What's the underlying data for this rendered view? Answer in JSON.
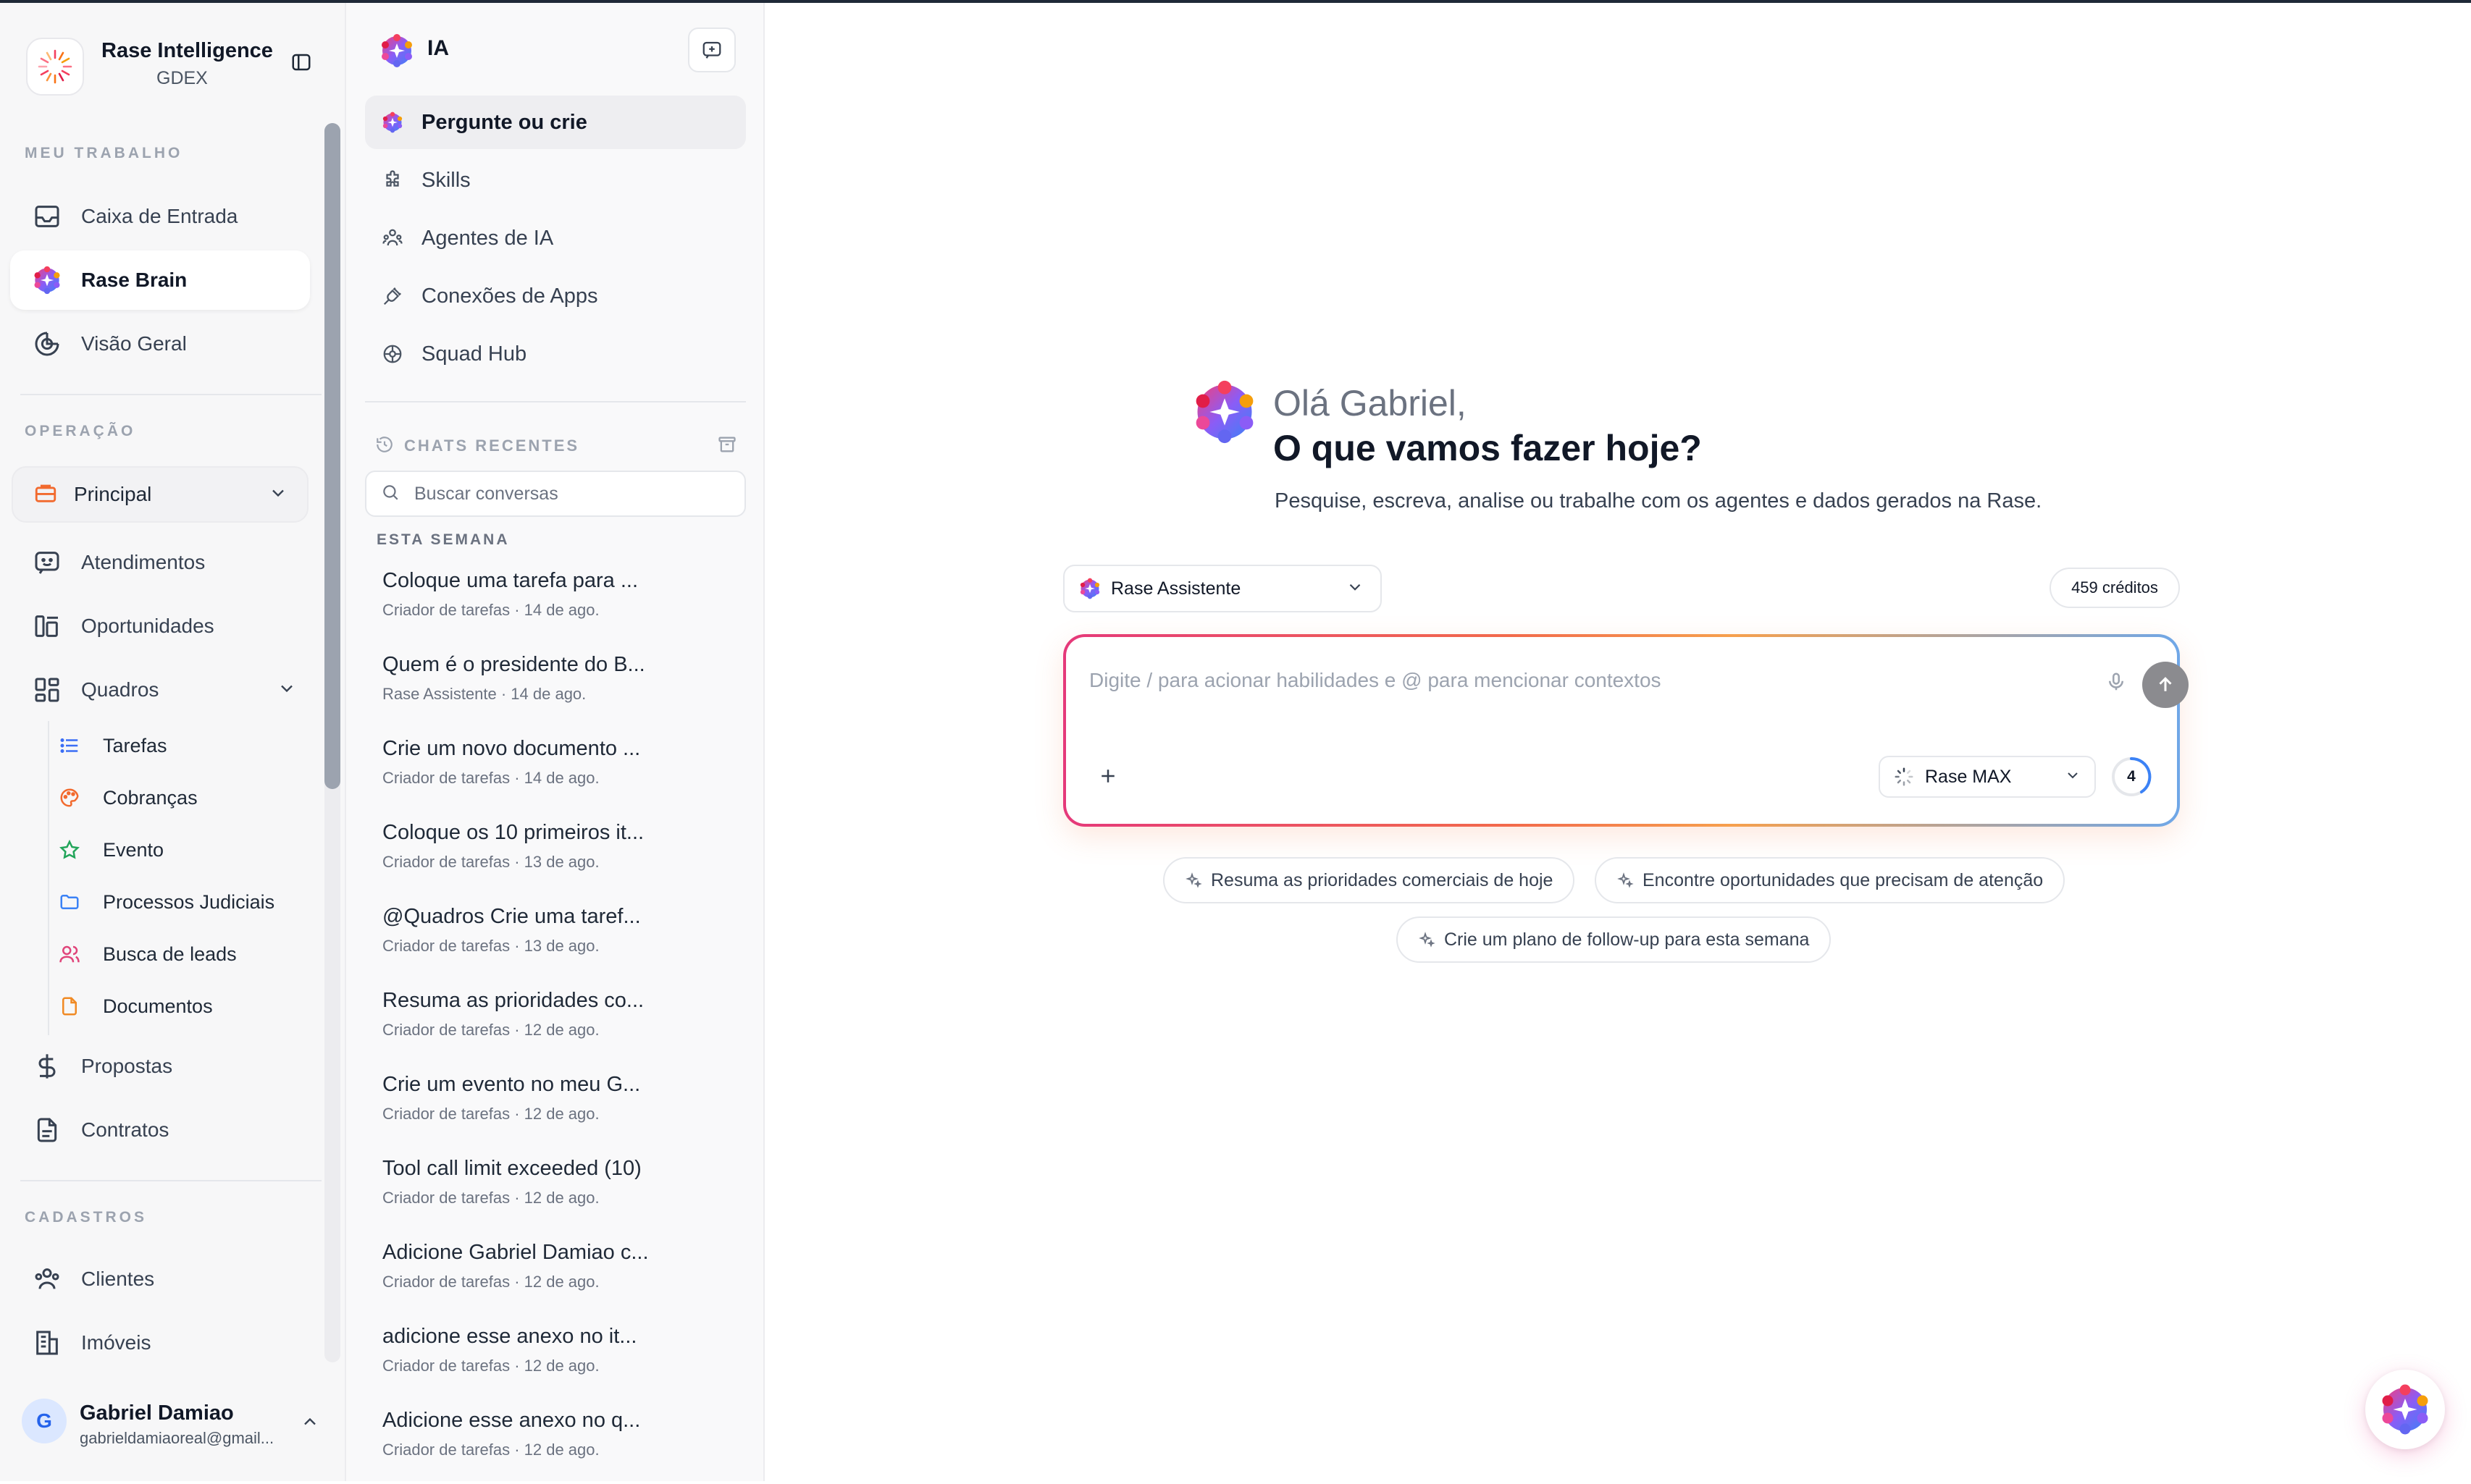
{
  "brand": {
    "name": "Rase Intelligence",
    "workspace": "GDEX"
  },
  "sidebar": {
    "section_work": "MEU TRABALHO",
    "work_items": [
      {
        "label": "Caixa de Entrada",
        "icon": "inbox-icon"
      },
      {
        "label": "Rase Brain",
        "icon": "rase-brain-icon",
        "active": true
      },
      {
        "label": "Visão Geral",
        "icon": "pie-chart-icon"
      }
    ],
    "section_operation": "OPERAÇÃO",
    "operation_selector": "Principal",
    "operation_items": [
      {
        "label": "Atendimentos",
        "icon": "chat-smile-icon"
      },
      {
        "label": "Oportunidades",
        "icon": "kanban-icon"
      },
      {
        "label": "Quadros",
        "icon": "boards-icon"
      }
    ],
    "boards": [
      {
        "label": "Tarefas",
        "icon": "list-icon",
        "color": "#3b6ef5"
      },
      {
        "label": "Cobranças",
        "icon": "palette-icon",
        "color": "#f26a2e"
      },
      {
        "label": "Evento",
        "icon": "star-icon",
        "color": "#22a55a"
      },
      {
        "label": "Processos Judiciais",
        "icon": "folder-icon",
        "color": "#3b82f6"
      },
      {
        "label": "Busca de leads",
        "icon": "users-icon",
        "color": "#e0447a"
      },
      {
        "label": "Documentos",
        "icon": "file-icon",
        "color": "#f08a24"
      }
    ],
    "after_items": [
      {
        "label": "Propostas",
        "icon": "dollar-icon"
      },
      {
        "label": "Contratos",
        "icon": "document-icon"
      }
    ],
    "section_registry": "CADASTROS",
    "registry_items": [
      {
        "label": "Clientes",
        "icon": "contacts-icon"
      },
      {
        "label": "Imóveis",
        "icon": "building-icon"
      }
    ],
    "user": {
      "initial": "G",
      "name": "Gabriel Damiao",
      "email": "gabrieldamiaoreal@gmail..."
    }
  },
  "ia_panel": {
    "title": "IA",
    "nav": [
      {
        "label": "Pergunte ou crie",
        "icon": "rase-brain-icon",
        "active": true
      },
      {
        "label": "Skills",
        "icon": "puzzle-icon"
      },
      {
        "label": "Agentes de IA",
        "icon": "agents-icon"
      },
      {
        "label": "Conexões de Apps",
        "icon": "plug-icon"
      },
      {
        "label": "Squad Hub",
        "icon": "hub-icon"
      }
    ],
    "recent_label": "CHATS RECENTES",
    "search_placeholder": "Buscar conversas",
    "week_label": "ESTA SEMANA",
    "chats": [
      {
        "title": "Coloque uma tarefa para ...",
        "meta": "Criador de tarefas · 14 de ago."
      },
      {
        "title": "Quem é o presidente do B...",
        "meta": "Rase Assistente · 14 de ago."
      },
      {
        "title": "Crie um novo documento ...",
        "meta": "Criador de tarefas · 14 de ago."
      },
      {
        "title": "Coloque os 10 primeiros it...",
        "meta": "Criador de tarefas · 13 de ago."
      },
      {
        "title": "@Quadros Crie uma taref...",
        "meta": "Criador de tarefas · 13 de ago."
      },
      {
        "title": "Resuma as prioridades co...",
        "meta": "Criador de tarefas · 12 de ago."
      },
      {
        "title": "Crie um evento no meu G...",
        "meta": "Criador de tarefas · 12 de ago."
      },
      {
        "title": "Tool call limit exceeded (10)",
        "meta": "Criador de tarefas · 12 de ago."
      },
      {
        "title": "Adicione Gabriel Damiao c...",
        "meta": "Criador de tarefas · 12 de ago."
      },
      {
        "title": "adicione esse anexo no it...",
        "meta": "Criador de tarefas · 12 de ago."
      },
      {
        "title": "Adicione esse anexo no q...",
        "meta": "Criador de tarefas · 12 de ago."
      }
    ]
  },
  "main": {
    "greeting": "Olá Gabriel,",
    "headline": "O que vamos fazer hoje?",
    "subtitle": "Pesquise, escreva, analise ou trabalhe com os agentes e dados gerados na Rase.",
    "agent": "Rase Assistente",
    "credits": "459 créditos",
    "composer_placeholder": "Digite / para acionar habilidades e @ para mencionar contextos",
    "model": "Rase MAX",
    "counter": "4",
    "suggestions": [
      "Resuma as prioridades comerciais de hoje",
      "Encontre oportunidades que precisam de atenção",
      "Crie um plano de follow-up para esta semana"
    ]
  },
  "colors": {
    "accent_pink": "#e5397a",
    "accent_orange": "#f6a04d",
    "accent_blue": "#6fa7e8"
  }
}
